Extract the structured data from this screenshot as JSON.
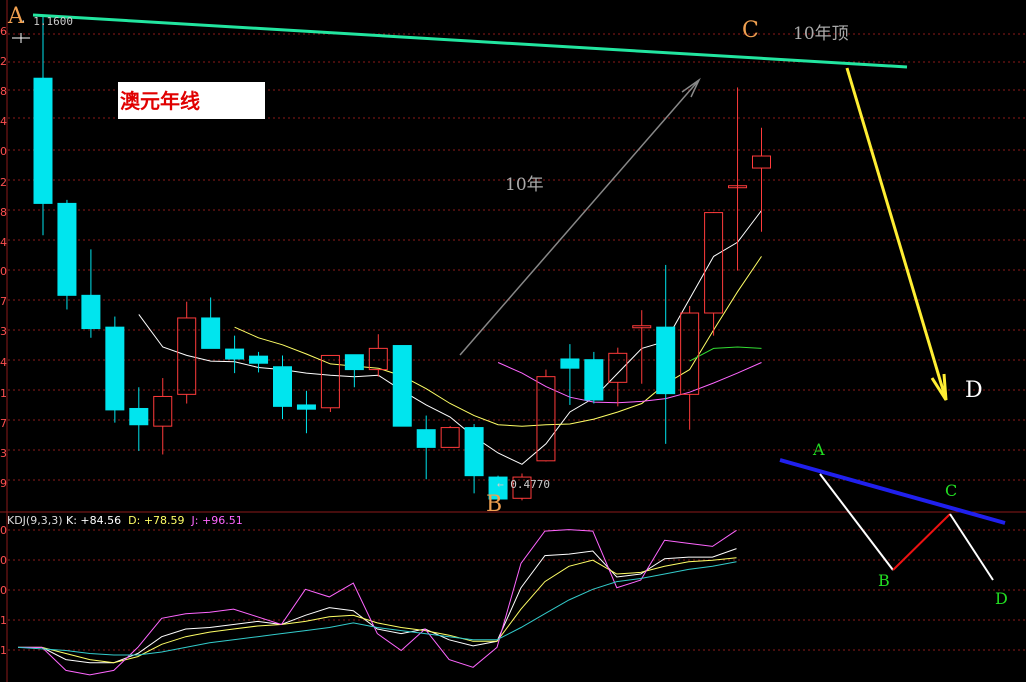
{
  "colors": {
    "background": "#000000",
    "grid": "#8b1a1a",
    "up_candle": "#ff3b3b",
    "down_candle": "#00e5ee",
    "ma5": "#ffffff",
    "ma10": "#ffff66",
    "ma20": "#ff66ff",
    "ma60": "#33dd33",
    "trend_a_c": "#22e6a0",
    "projection": "#ffee33",
    "kdj_k": "#ffffff",
    "kdj_d": "#ffff66",
    "kdj_j": "#ff66ff",
    "kdj_extra": "#33cccc"
  },
  "chart_data": [
    {
      "type": "candlestick",
      "title": "澳元年线",
      "ylim": [
        0.47,
        1.17
      ],
      "ytick_labels_partial": [
        "6",
        "2",
        "8",
        "4",
        "0",
        "2",
        "8",
        "4",
        "0",
        "7",
        "3",
        "4",
        "1",
        "7",
        "3",
        "9"
      ],
      "grid": true,
      "candles": [
        {
          "o": 1.072,
          "h": 1.16,
          "l": 0.85,
          "c": 0.895
        },
        {
          "o": 0.895,
          "h": 0.9,
          "l": 0.745,
          "c": 0.765
        },
        {
          "o": 0.765,
          "h": 0.83,
          "l": 0.705,
          "c": 0.718
        },
        {
          "o": 0.72,
          "h": 0.735,
          "l": 0.585,
          "c": 0.603
        },
        {
          "o": 0.605,
          "h": 0.635,
          "l": 0.545,
          "c": 0.582
        },
        {
          "o": 0.58,
          "h": 0.648,
          "l": 0.54,
          "c": 0.622
        },
        {
          "o": 0.625,
          "h": 0.756,
          "l": 0.612,
          "c": 0.733
        },
        {
          "o": 0.733,
          "h": 0.762,
          "l": 0.69,
          "c": 0.69
        },
        {
          "o": 0.689,
          "h": 0.708,
          "l": 0.655,
          "c": 0.675
        },
        {
          "o": 0.679,
          "h": 0.685,
          "l": 0.656,
          "c": 0.669
        },
        {
          "o": 0.664,
          "h": 0.68,
          "l": 0.59,
          "c": 0.608
        },
        {
          "o": 0.61,
          "h": 0.63,
          "l": 0.57,
          "c": 0.604
        },
        {
          "o": 0.606,
          "h": 0.68,
          "l": 0.6,
          "c": 0.68
        },
        {
          "o": 0.681,
          "h": 0.681,
          "l": 0.635,
          "c": 0.66
        },
        {
          "o": 0.66,
          "h": 0.71,
          "l": 0.65,
          "c": 0.69
        },
        {
          "o": 0.694,
          "h": 0.694,
          "l": 0.58,
          "c": 0.58
        },
        {
          "o": 0.575,
          "h": 0.595,
          "l": 0.505,
          "c": 0.55
        },
        {
          "o": 0.55,
          "h": 0.58,
          "l": 0.55,
          "c": 0.578
        },
        {
          "o": 0.578,
          "h": 0.583,
          "l": 0.485,
          "c": 0.51
        },
        {
          "o": 0.508,
          "h": 0.51,
          "l": 0.477,
          "c": 0.477
        },
        {
          "o": 0.478,
          "h": 0.513,
          "l": 0.475,
          "c": 0.508
        },
        {
          "o": 0.531,
          "h": 0.66,
          "l": 0.53,
          "c": 0.65
        },
        {
          "o": 0.675,
          "h": 0.696,
          "l": 0.61,
          "c": 0.662
        },
        {
          "o": 0.674,
          "h": 0.685,
          "l": 0.612,
          "c": 0.617
        },
        {
          "o": 0.642,
          "h": 0.691,
          "l": 0.608,
          "c": 0.683
        },
        {
          "o": 0.72,
          "h": 0.744,
          "l": 0.64,
          "c": 0.722
        },
        {
          "o": 0.72,
          "h": 0.808,
          "l": 0.555,
          "c": 0.626
        },
        {
          "o": 0.625,
          "h": 0.75,
          "l": 0.575,
          "c": 0.74
        },
        {
          "o": 0.74,
          "h": 0.883,
          "l": 0.708,
          "c": 0.882
        },
        {
          "o": 0.92,
          "h": 1.059,
          "l": 0.8,
          "c": 0.92
        },
        {
          "o": 0.945,
          "h": 1.002,
          "l": 0.855,
          "c": 0.962
        }
      ],
      "moving_averages": {
        "ma5": [
          null,
          null,
          null,
          null,
          0.738,
          0.692,
          0.68,
          0.672,
          0.671,
          0.663,
          0.66,
          0.655,
          0.652,
          0.65,
          0.652,
          0.63,
          0.61,
          0.593,
          0.565,
          0.542,
          0.526,
          0.555,
          0.6,
          0.62,
          0.655,
          0.69,
          0.7,
          0.76,
          0.82,
          0.84,
          0.885
        ],
        "ma10": [
          null,
          null,
          null,
          null,
          null,
          null,
          null,
          null,
          0.72,
          0.705,
          0.695,
          0.682,
          0.668,
          0.665,
          0.662,
          0.651,
          0.633,
          0.612,
          0.595,
          0.582,
          0.58,
          0.582,
          0.583,
          0.59,
          0.6,
          0.612,
          0.64,
          0.66,
          0.716,
          0.77,
          0.82
        ],
        "ma20": [
          null,
          null,
          null,
          null,
          null,
          null,
          null,
          null,
          null,
          null,
          null,
          null,
          null,
          null,
          null,
          null,
          null,
          null,
          null,
          0.67,
          0.655,
          0.636,
          0.621,
          0.614,
          0.613,
          0.615,
          0.619,
          0.628,
          0.641,
          0.655,
          0.67
        ],
        "ma60": [
          null,
          null,
          null,
          null,
          null,
          null,
          null,
          null,
          null,
          null,
          null,
          null,
          null,
          null,
          null,
          null,
          null,
          null,
          null,
          null,
          null,
          null,
          null,
          null,
          null,
          null,
          null,
          0.672,
          0.69,
          0.692,
          0.69
        ]
      },
      "annotations": {
        "max_price_label": "1.1600",
        "min_price_label": "0.4770",
        "point_a": "A",
        "point_b": "B",
        "point_c": "C",
        "point_d": "D",
        "top_note": "10年顶",
        "cycle_note": "10年"
      }
    },
    {
      "type": "line",
      "title": "KDJ(9,3,3)",
      "legend": [
        {
          "name": "K:",
          "value": "+84.56"
        },
        {
          "name": "D:",
          "value": "+78.59"
        },
        {
          "name": "J:",
          "value": "+96.51"
        }
      ],
      "ytick_labels_partial": [
        "0",
        "0",
        "0",
        "1",
        "1"
      ],
      "series": [
        {
          "name": "K",
          "values": [
            20,
            20,
            12,
            10,
            10,
            16,
            27,
            32,
            33,
            35,
            37,
            35,
            41,
            46,
            44,
            32,
            29,
            32,
            25,
            21,
            24,
            59,
            80,
            81,
            83,
            66,
            68,
            78,
            79,
            79,
            84.56
          ]
        },
        {
          "name": "D",
          "values": [
            20,
            20,
            16,
            12,
            10,
            14,
            22,
            27,
            30,
            32,
            34,
            35,
            37,
            40,
            41,
            36,
            33,
            31,
            28,
            24,
            24,
            45,
            63,
            73,
            77,
            68,
            69,
            73,
            76,
            77,
            78.59
          ]
        },
        {
          "name": "J",
          "values": [
            20,
            20,
            5,
            2,
            5,
            20,
            39,
            42,
            43,
            45,
            40,
            35,
            58,
            53,
            62,
            29,
            18,
            32,
            12,
            7,
            20,
            75,
            96,
            97,
            96,
            59,
            64,
            90,
            88,
            86,
            96.51
          ]
        },
        {
          "values": [
            20,
            19,
            18,
            16,
            15,
            15,
            17,
            20,
            23,
            25,
            27,
            29,
            31,
            33,
            36,
            33,
            31,
            29,
            27,
            25,
            25,
            33,
            42,
            51,
            58,
            63,
            65,
            68,
            71,
            73,
            76
          ]
        }
      ]
    },
    {
      "type": "diagram",
      "labels": [
        "A",
        "B",
        "C",
        "D"
      ]
    }
  ]
}
